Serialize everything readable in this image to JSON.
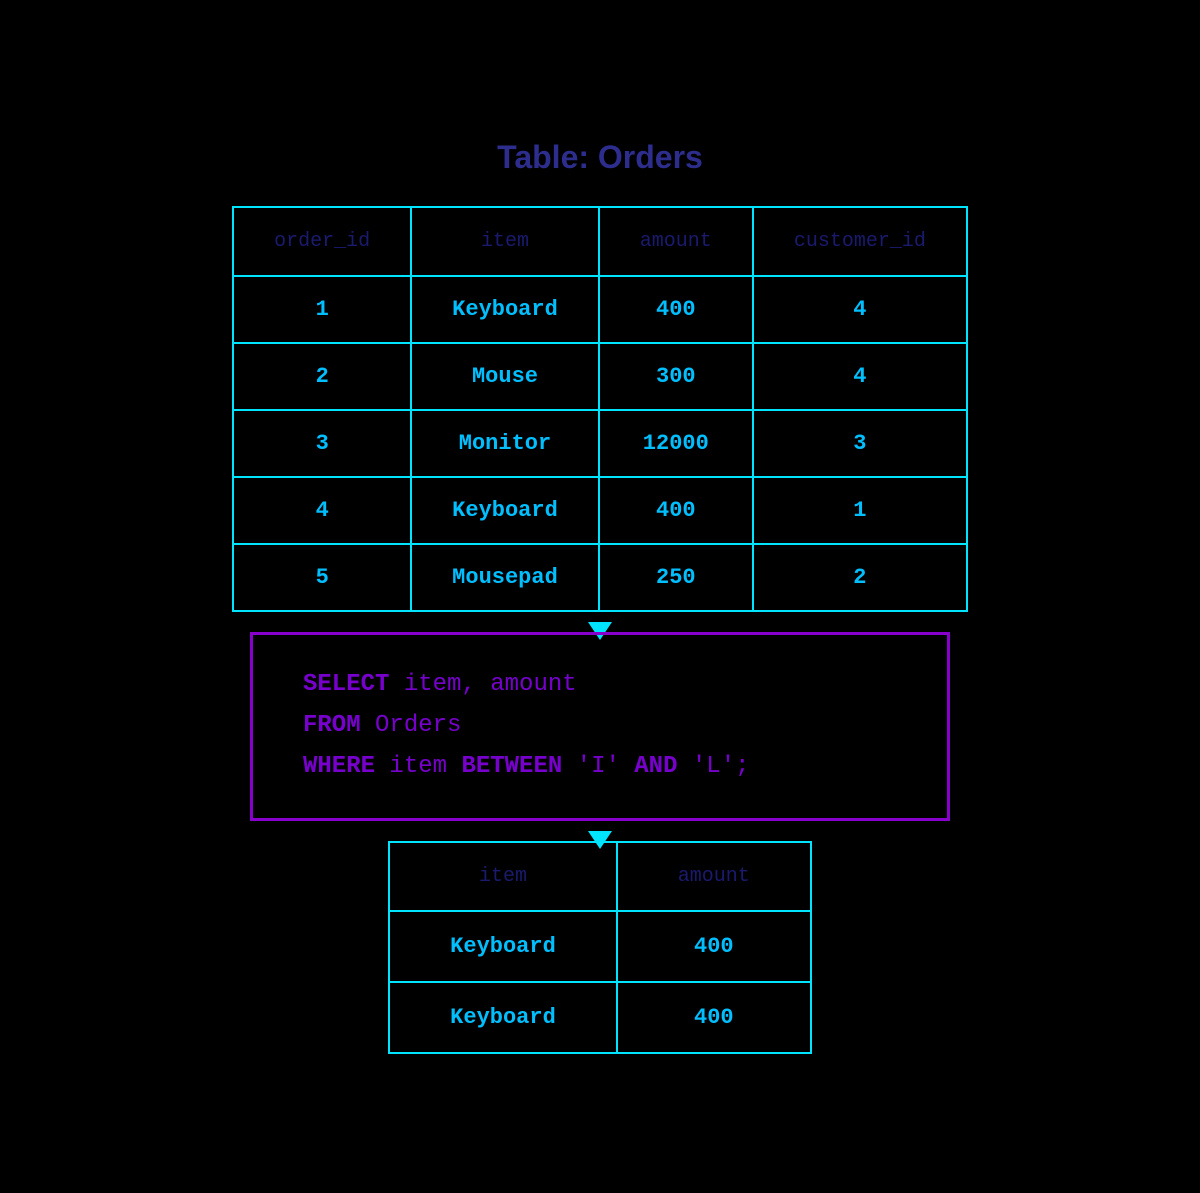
{
  "title": "Table: Orders",
  "orders_table": {
    "headers": [
      "order_id",
      "item",
      "amount",
      "customer_id"
    ],
    "rows": [
      [
        "1",
        "Keyboard",
        "400",
        "4"
      ],
      [
        "2",
        "Mouse",
        "300",
        "4"
      ],
      [
        "3",
        "Monitor",
        "12000",
        "3"
      ],
      [
        "4",
        "Keyboard",
        "400",
        "1"
      ],
      [
        "5",
        "Mousepad",
        "250",
        "2"
      ]
    ]
  },
  "sql": {
    "line1_kw": "SELECT",
    "line1_rest": " item, amount",
    "line2_kw": "FROM",
    "line2_rest": " Orders",
    "line3_kw": "WHERE",
    "line3_mid": " item ",
    "line3_kw2": "BETWEEN",
    "line3_val1": " 'I' ",
    "line3_kw3": "AND",
    "line3_val2": " 'L';"
  },
  "result_table": {
    "headers": [
      "item",
      "amount"
    ],
    "rows": [
      [
        "Keyboard",
        "400"
      ],
      [
        "Keyboard",
        "400"
      ]
    ]
  }
}
